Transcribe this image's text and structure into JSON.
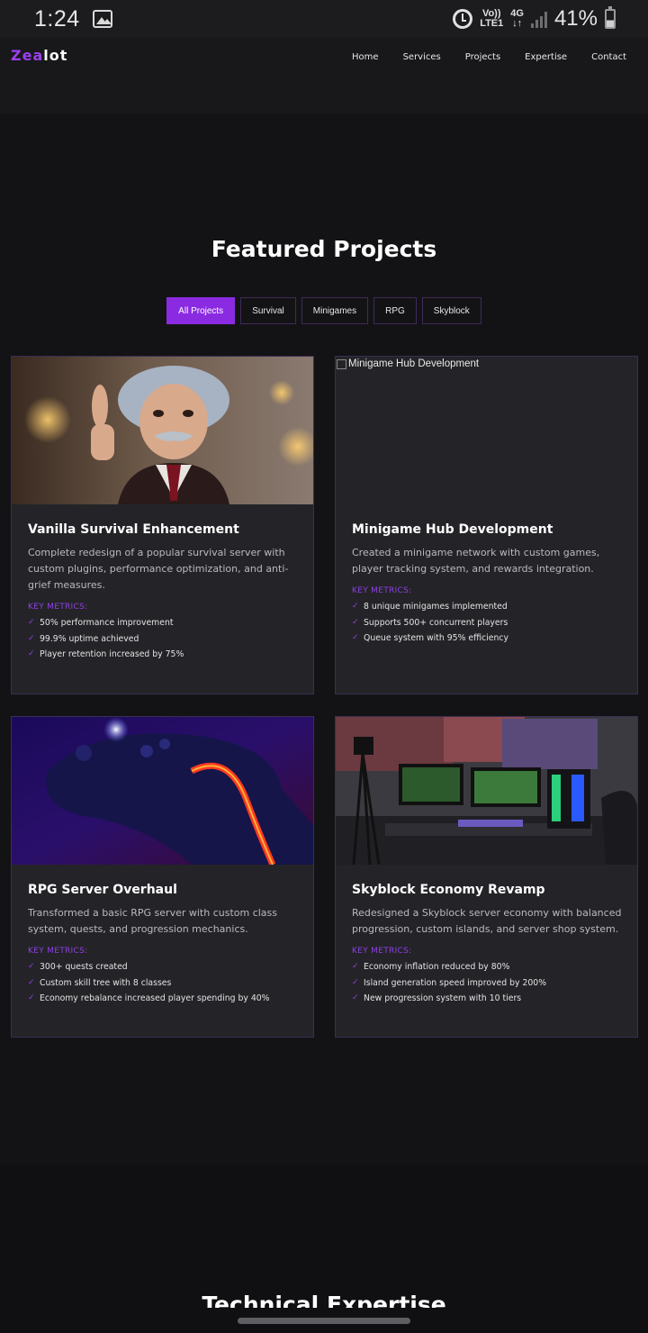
{
  "status_bar": {
    "time": "1:24",
    "volte_line1": "Vo))",
    "volte_line2": "LTE1",
    "network_line1": "4G",
    "network_line2": "↓↑",
    "battery": "41%"
  },
  "header": {
    "logo_part1": "Zea",
    "logo_part2": "lot",
    "nav": [
      "Home",
      "Services",
      "Projects",
      "Expertise",
      "Contact"
    ]
  },
  "projects": {
    "title": "Featured Projects",
    "filters": [
      "All Projects",
      "Survival",
      "Minigames",
      "RPG",
      "Skyblock"
    ],
    "active_filter": "All Projects",
    "cards": [
      {
        "title": "Vanilla Survival Enhancement",
        "description": "Complete redesign of a popular survival server with custom plugins, performance optimization, and anti-grief measures.",
        "metrics_label": "KEY METRICS:",
        "metrics": [
          "50% performance improvement",
          "99.9% uptime achieved",
          "Player retention increased by 75%"
        ]
      },
      {
        "image_alt": "Minigame Hub Development",
        "title": "Minigame Hub Development",
        "description": "Created a minigame network with custom games, player tracking system, and rewards integration.",
        "metrics_label": "KEY METRICS:",
        "metrics": [
          "8 unique minigames implemented",
          "Supports 500+ concurrent players",
          "Queue system with 95% efficiency"
        ]
      },
      {
        "title": "RPG Server Overhaul",
        "description": "Transformed a basic RPG server with custom class system, quests, and progression mechanics.",
        "metrics_label": "KEY METRICS:",
        "metrics": [
          "300+ quests created",
          "Custom skill tree with 8 classes",
          "Economy rebalance increased player spending by 40%"
        ]
      },
      {
        "title": "Skyblock Economy Revamp",
        "description": "Redesigned a Skyblock server economy with balanced progression, custom islands, and server shop system.",
        "metrics_label": "KEY METRICS:",
        "metrics": [
          "Economy inflation reduced by 80%",
          "Island generation speed improved by 200%",
          "New progression system with 10 tiers"
        ]
      }
    ],
    "check_glyph": "✓"
  },
  "expertise": {
    "title": "Technical Expertise"
  },
  "colors": {
    "accent": "#8a2be2",
    "background": "#131315",
    "card": "#242428"
  }
}
